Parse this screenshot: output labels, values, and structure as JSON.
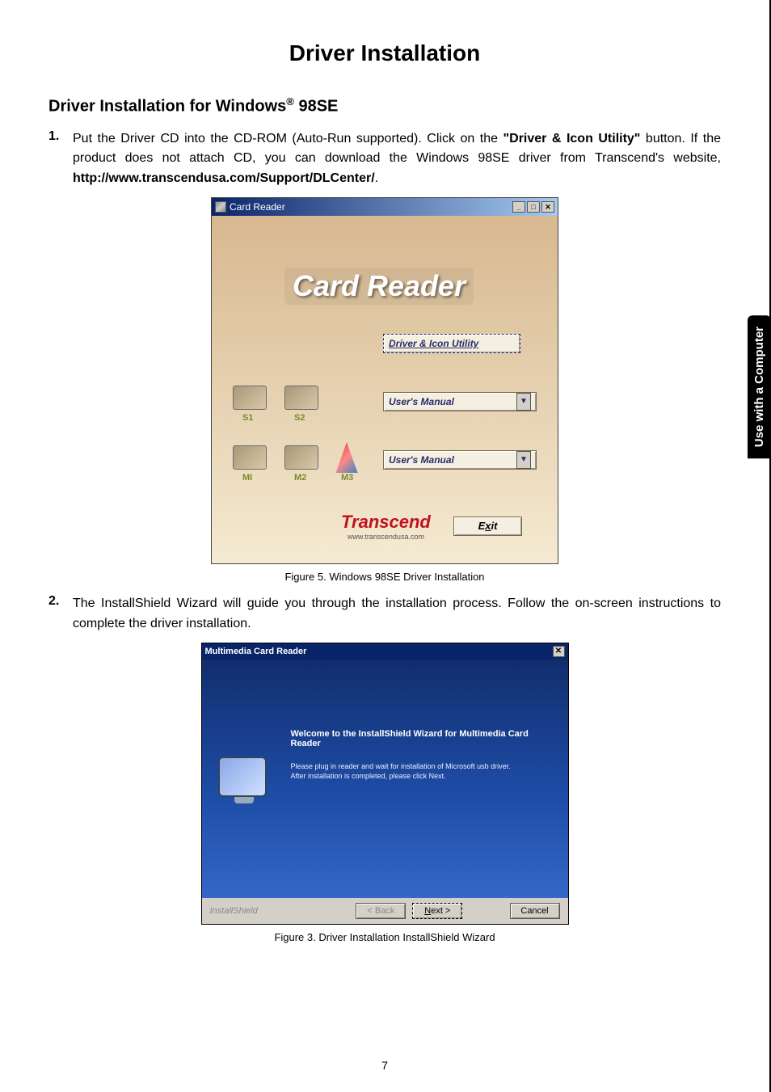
{
  "title": "Driver Installation",
  "subtitle_prefix": "Driver Installation for Windows",
  "subtitle_suffix": "98SE",
  "side_tab": "Use with a Computer",
  "page_number": "7",
  "steps": {
    "s1_num": "1.",
    "s1_text_a": "Put the Driver CD into the CD-ROM (Auto-Run supported). Click on the ",
    "s1_bold": "\"Driver & Icon Utility\"",
    "s1_text_b": " button. If the product does not attach CD, you can download the Windows 98SE driver from Transcend's website, ",
    "s1_url": "http://www.transcendusa.com/Support/DLCenter/",
    "s1_text_c": ".",
    "s2_num": "2.",
    "s2_text": "The InstallShield Wizard will guide you through the installation process. Follow the on-screen instructions to complete the driver installation."
  },
  "captions": {
    "fig1": "Figure 5. Windows 98SE Driver Installation",
    "fig2": "Figure 3. Driver Installation InstallShield Wizard"
  },
  "card_reader": {
    "window_title": "Card Reader",
    "banner": "Card Reader",
    "driver_btn": "Driver & Icon Utility",
    "manual1": "User's Manual",
    "manual2": "User's Manual",
    "slot_s1": "S1",
    "slot_s2": "S2",
    "slot_m1": "MI",
    "slot_m2": "M2",
    "slot_m3": "M3",
    "brand": "Transcend",
    "brand_url": "www.transcendusa.com",
    "exit_prefix": "E",
    "exit_u": "x",
    "exit_suffix": "it",
    "min": "_",
    "max": "□",
    "close": "✕"
  },
  "installshield": {
    "window_title": "Multimedia Card Reader",
    "close": "✕",
    "headline": "Welcome to the InstallShield Wizard for Multimedia Card Reader",
    "msg1": "Please plug in reader and wait for installation of Microsoft usb driver.",
    "msg2": "After installation is completed, please click Next.",
    "footer_brand": "InstallShield",
    "back": "< Back",
    "next_u": "N",
    "next_rest": "ext >",
    "cancel": "Cancel"
  }
}
